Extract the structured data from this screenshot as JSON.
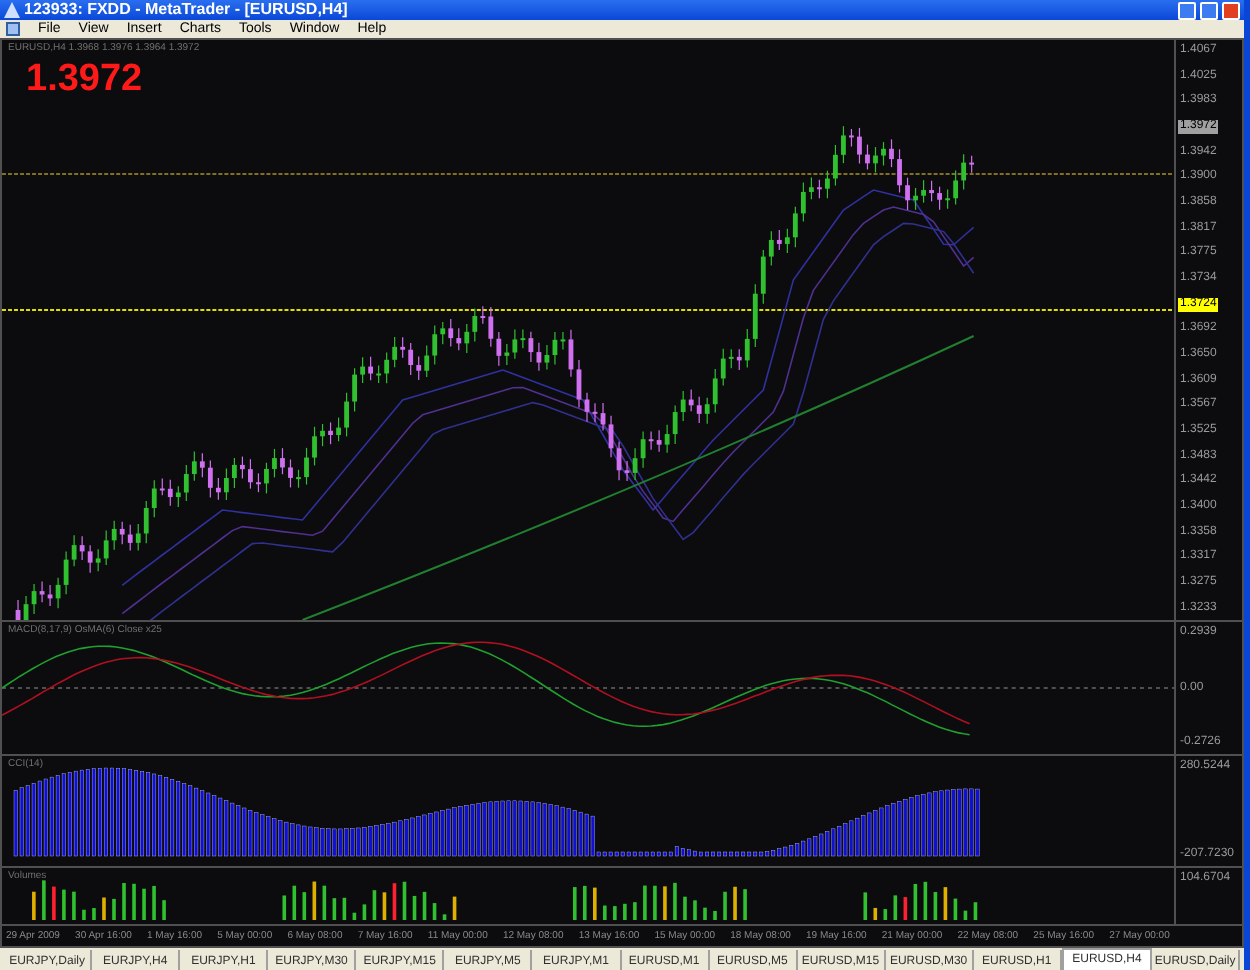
{
  "window": {
    "title": "123933: FXDD - MetaTrader - [EURUSD,H4]"
  },
  "menu": [
    "File",
    "View",
    "Insert",
    "Charts",
    "Tools",
    "Window",
    "Help"
  ],
  "chart": {
    "header": "EURUSD,H4 1.3968 1.3976 1.3964 1.3972",
    "price": "1.3972",
    "axis": [
      {
        "label": "1.4067",
        "kind": "tick"
      },
      {
        "label": "1.4025",
        "kind": "tick"
      },
      {
        "label": "1.3983",
        "kind": "tick"
      },
      {
        "label": "1.3972",
        "kind": "bid"
      },
      {
        "label": "1.3942",
        "kind": "tick"
      },
      {
        "label": "1.3900",
        "kind": "tick"
      },
      {
        "label": "1.3858",
        "kind": "tick"
      },
      {
        "label": "1.3817",
        "kind": "tick"
      },
      {
        "label": "1.3775",
        "kind": "tick"
      },
      {
        "label": "1.3734",
        "kind": "tick"
      },
      {
        "label": "1.3724",
        "kind": "level"
      },
      {
        "label": "1.3692",
        "kind": "tick"
      },
      {
        "label": "1.3650",
        "kind": "tick"
      },
      {
        "label": "1.3609",
        "kind": "tick"
      },
      {
        "label": "1.3567",
        "kind": "tick"
      },
      {
        "label": "1.3525",
        "kind": "tick"
      },
      {
        "label": "1.3483",
        "kind": "tick"
      },
      {
        "label": "1.3442",
        "kind": "tick"
      },
      {
        "label": "1.3400",
        "kind": "tick"
      },
      {
        "label": "1.3358",
        "kind": "tick"
      },
      {
        "label": "1.3317",
        "kind": "tick"
      },
      {
        "label": "1.3275",
        "kind": "tick"
      },
      {
        "label": "1.3233",
        "kind": "tick"
      }
    ]
  },
  "panels": [
    {
      "title": "MACD(8,17,9) OsMA(6) Close x25",
      "axis": [
        "0.2939",
        "0.00",
        "-0.2726"
      ]
    },
    {
      "title": "CCI(14)",
      "axis": [
        "280.5244",
        "-207.7230"
      ]
    },
    {
      "title": "Volumes",
      "axis": [
        "104.6704"
      ]
    }
  ],
  "xaxis": [
    "29 Apr 2009",
    "30 Apr 16:00",
    "1 May 16:00",
    "5 May 00:00",
    "6 May 08:00",
    "7 May 16:00",
    "11 May 00:00",
    "12 May 08:00",
    "13 May 16:00",
    "15 May 00:00",
    "18 May 08:00",
    "19 May 16:00",
    "21 May 00:00",
    "22 May 08:00",
    "25 May 16:00",
    "27 May 00:00"
  ],
  "tabs": [
    {
      "label": "EURJPY,Daily",
      "selected": false
    },
    {
      "label": "EURJPY,H4",
      "selected": false
    },
    {
      "label": "EURJPY,H1",
      "selected": false
    },
    {
      "label": "EURJPY,M30",
      "selected": false
    },
    {
      "label": "EURJPY,M15",
      "selected": false
    },
    {
      "label": "EURJPY,M5",
      "selected": false
    },
    {
      "label": "EURJPY,M1",
      "selected": false
    },
    {
      "label": "EURUSD,M1",
      "selected": false
    },
    {
      "label": "EURUSD,M5",
      "selected": false
    },
    {
      "label": "EURUSD,M15",
      "selected": false
    },
    {
      "label": "EURUSD,M30",
      "selected": false
    },
    {
      "label": "EURUSD,H1",
      "selected": false
    },
    {
      "label": "EURUSD,H4",
      "selected": true
    },
    {
      "label": "EURUSD,Daily",
      "selected": false
    }
  ]
}
